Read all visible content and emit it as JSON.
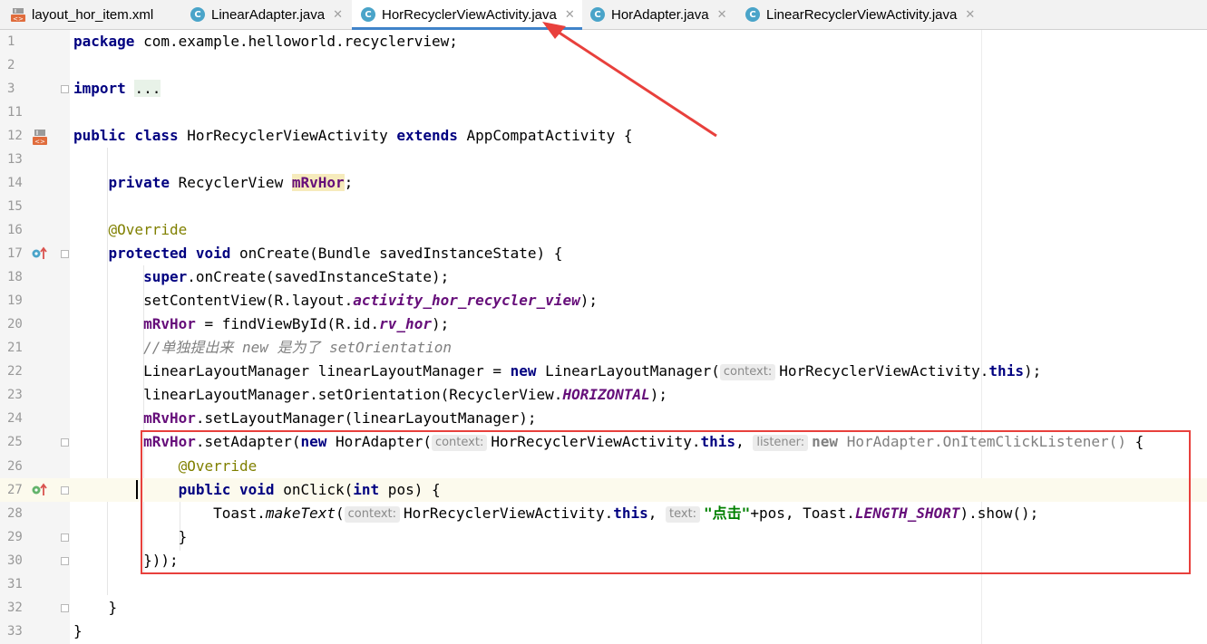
{
  "tabs": [
    {
      "label": "layout_hor_item.xml",
      "icon": "xml-layout-icon",
      "active": false,
      "closable": false
    },
    {
      "label": "LinearAdapter.java",
      "icon": "java-class-icon",
      "active": false,
      "closable": true
    },
    {
      "label": "HorRecyclerViewActivity.java",
      "icon": "java-class-icon",
      "active": true,
      "closable": true
    },
    {
      "label": "HorAdapter.java",
      "icon": "java-class-icon",
      "active": false,
      "closable": true
    },
    {
      "label": "LinearRecyclerViewActivity.java",
      "icon": "java-class-icon",
      "active": false,
      "closable": true
    }
  ],
  "tab_icon_letter": "C",
  "close_glyph": "✕",
  "annotation_color": "#e8403c",
  "accent_color": "#4083c9",
  "editor": {
    "line_numbers": [
      "1",
      "2",
      "3",
      "11",
      "12",
      "13",
      "14",
      "15",
      "16",
      "17",
      "18",
      "19",
      "20",
      "21",
      "22",
      "23",
      "24",
      "25",
      "26",
      "27",
      "28",
      "29",
      "30",
      "31",
      "32",
      "33"
    ],
    "code": {
      "l1a": "package",
      "l1b": " com.example.helloworld.recyclerview;",
      "l3a": "import",
      "l3b": " ",
      "l3c": "...",
      "l12a": "public class",
      "l12b": " HorRecyclerViewActivity ",
      "l12c": "extends",
      "l12d": " AppCompatActivity {",
      "l14a": "    private",
      "l14b": " RecyclerView ",
      "l14c": "mRvHor",
      "l14d": ";",
      "l16": "    @Override",
      "l17a": "    protected void",
      "l17b": " onCreate(Bundle savedInstanceState) {",
      "l18a": "        super",
      "l18b": ".onCreate(savedInstanceState);",
      "l19a": "        setContentView(R.layout.",
      "l19b": "activity_hor_recycler_view",
      "l19c": ");",
      "l20a": "        ",
      "l20b": "mRvHor",
      "l20c": " = findViewById(R.id.",
      "l20d": "rv_hor",
      "l20e": ");",
      "l21": "        //单独提出来 new 是为了 setOrientation",
      "l22a": "        LinearLayoutManager linearLayoutManager = ",
      "l22b": "new",
      "l22c": " LinearLayoutManager(",
      "l22hint": "context:",
      "l22d": "HorRecyclerViewActivity.",
      "l22e": "this",
      "l22f": ");",
      "l23a": "        linearLayoutManager.setOrientation(RecyclerView.",
      "l23b": "HORIZONTAL",
      "l23c": ");",
      "l24a": "        ",
      "l24b": "mRvHor",
      "l24c": ".setLayoutManager(linearLayoutManager);",
      "l25a": "        ",
      "l25b": "mRvHor",
      "l25c": ".setAdapter(",
      "l25d": "new",
      "l25e": " HorAdapter(",
      "l25hint1": "context:",
      "l25f": "HorRecyclerViewActivity.",
      "l25g": "this",
      "l25h": ", ",
      "l25hint2": "listener:",
      "l25i": "new",
      "l25j": " HorAdapter.OnItemClickListener()",
      "l25k": " {",
      "l26": "            @Override",
      "l27a": "            public void",
      "l27b": " onClick(",
      "l27c": "int",
      "l27d": " pos) {",
      "l28a": "                Toast.",
      "l28b": "makeText",
      "l28c": "(",
      "l28hint1": "context:",
      "l28d": "HorRecyclerViewActivity.",
      "l28e": "this",
      "l28f": ", ",
      "l28hint2": "text:",
      "l28g": "\"点击\"",
      "l28h": "+pos, Toast.",
      "l28i": "LENGTH_SHORT",
      "l28j": ").show();",
      "l29": "            }",
      "l30": "        }));",
      "l32": "    }",
      "l33": "}"
    }
  }
}
